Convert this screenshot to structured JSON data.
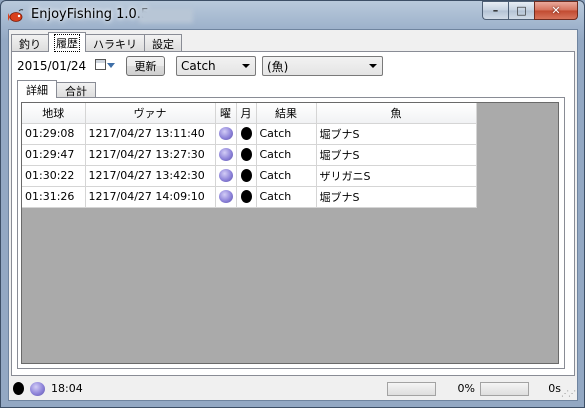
{
  "window": {
    "title": "EnjoyFishing 1.0.5",
    "buttons": {
      "minimize": "–",
      "maximize": "□",
      "close": "✕"
    }
  },
  "main_tabs": [
    {
      "label": "釣り",
      "active": false
    },
    {
      "label": "履歴",
      "active": true
    },
    {
      "label": "ハラキリ",
      "active": false
    },
    {
      "label": "設定",
      "active": false
    }
  ],
  "toolbar": {
    "date": "2015/01/24",
    "refresh_label": "更新",
    "result_filter": "Catch",
    "fish_filter": "(魚)"
  },
  "sub_tabs": [
    {
      "label": "詳細",
      "active": true
    },
    {
      "label": "合計",
      "active": false
    }
  ],
  "table": {
    "columns": [
      "地球",
      "ヴァナ",
      "曜",
      "月",
      "結果",
      "魚"
    ],
    "rows": [
      {
        "earth": "01:29:08",
        "vana": "1217/04/27 13:11:40",
        "weekday_icon": "gem-icon",
        "moon_icon": "moon-icon",
        "result": "Catch",
        "fish": "堀ブナS"
      },
      {
        "earth": "01:29:47",
        "vana": "1217/04/27 13:27:30",
        "weekday_icon": "gem-icon",
        "moon_icon": "moon-icon",
        "result": "Catch",
        "fish": "堀ブナS"
      },
      {
        "earth": "01:30:22",
        "vana": "1217/04/27 13:42:30",
        "weekday_icon": "gem-icon",
        "moon_icon": "moon-icon",
        "result": "Catch",
        "fish": "ザリガニS"
      },
      {
        "earth": "01:31:26",
        "vana": "1217/04/27 14:09:10",
        "weekday_icon": "gem-icon",
        "moon_icon": "moon-icon",
        "result": "Catch",
        "fish": "堀ブナS"
      }
    ]
  },
  "status": {
    "time": "18:04",
    "percent": "0%",
    "progress_fraction": 0,
    "seconds": "0s"
  },
  "colors": {
    "titlebar": "#9fb3cc",
    "close_button": "#c14a30",
    "grid_background": "#aaaaaa",
    "gem": "#8d83d9"
  }
}
